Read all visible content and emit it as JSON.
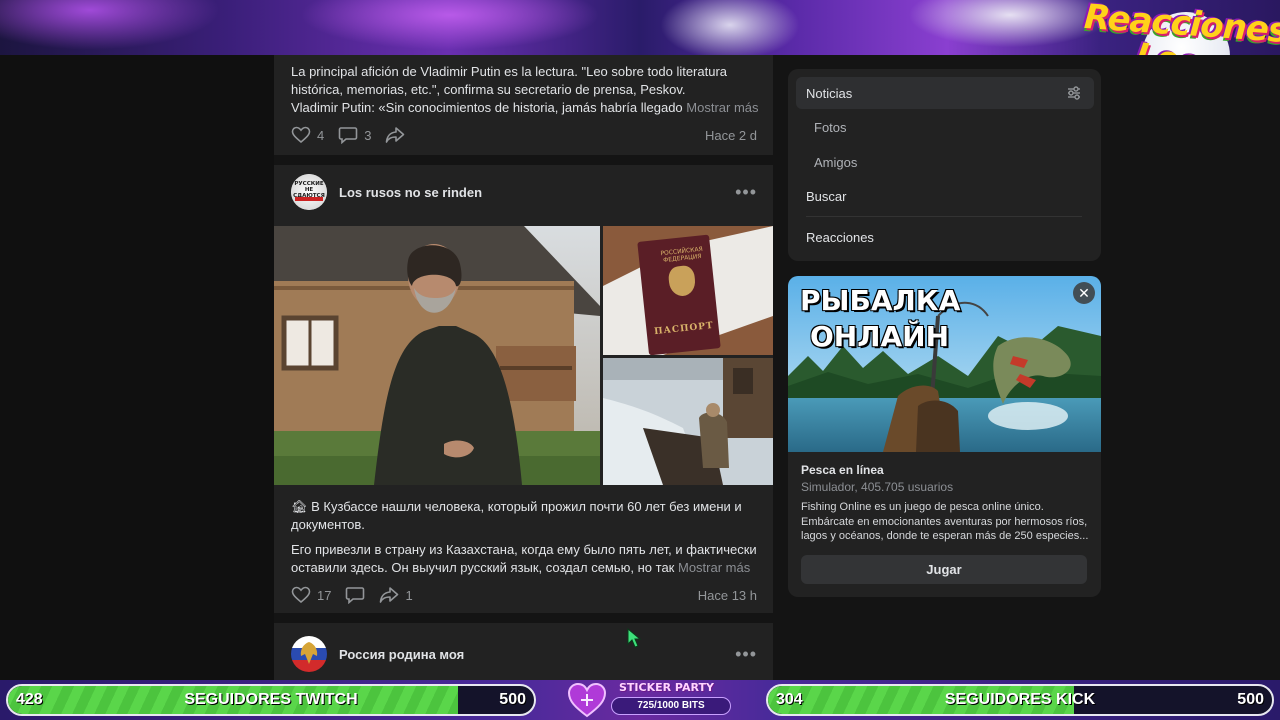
{
  "overlay": {
    "logo_line1": "Reacciones",
    "logo_line2": "Locas",
    "twitch": {
      "current": "428",
      "label": "SEGUIDORES TWITCH",
      "goal": "500",
      "progress": 0.856
    },
    "kick": {
      "current": "304",
      "label": "SEGUIDORES KICK",
      "goal": "500",
      "progress": 0.608
    },
    "sticker": {
      "title": "STICKER PARTY",
      "bits": "725/1000 BITS",
      "progress": 0.725
    }
  },
  "feed": {
    "post1": {
      "text_line1": "La principal afición de Vladimir Putin es la lectura. \"Leo sobre todo literatura",
      "text_line2": "histórica, memorias, etc.\", confirma su secretario de prensa, Peskov.",
      "text_line3": "Vladimir Putin: «Sin conocimientos de historia, jamás habría llegado",
      "more": "Mostrar más",
      "likes": "4",
      "comments": "3",
      "time": "Hace 2 d"
    },
    "post2": {
      "author": "Los rusos no se rinden",
      "avatar_text": "РУССКИЕ НЕ СДАЮТСЯ",
      "passport_text_top": "РОССИЙСКАЯ ФЕДЕРАЦИЯ",
      "passport_text": "ПАСПОРТ",
      "text_para1_line1": "🏚 В Кузбассе нашли человека, который прожил почти 60 лет без имени и",
      "text_para1_line2": "документов.",
      "text_para2_line1": "Его привезли в страну из Казахстана, когда ему было пять лет, и фактически",
      "text_para2_line2": "оставили здесь. Он выучил русский язык, создал семью, но так",
      "more": "Mostrar más",
      "likes": "17",
      "shares": "1",
      "time": "Hace 13 h"
    },
    "post3": {
      "author": "Россия родина моя"
    },
    "dots": "•••"
  },
  "menu": {
    "items": [
      {
        "label": "Noticias"
      },
      {
        "label": "Fotos"
      },
      {
        "label": "Amigos"
      },
      {
        "label": "Buscar"
      },
      {
        "label": "Reacciones"
      }
    ]
  },
  "ad": {
    "headline1": "РЫБАЛКА",
    "headline2": "ОНЛАЙН",
    "title": "Pesca en línea",
    "subtitle": "Simulador, 405.705 usuarios",
    "desc_line1": "Fishing Online es un juego de pesca online único.",
    "desc_line2": "Embárcate en emocionantes aventuras por hermosos ríos,",
    "desc_line3": "lagos y océanos, donde te esperan más de 250 especies...",
    "button": "Jugar",
    "close": "✕"
  },
  "icons": {
    "like": "heart-outline-icon",
    "comment": "comment-bubble-icon",
    "share": "share-arrow-icon",
    "filter": "filter-sliders-icon",
    "close": "close-icon"
  }
}
